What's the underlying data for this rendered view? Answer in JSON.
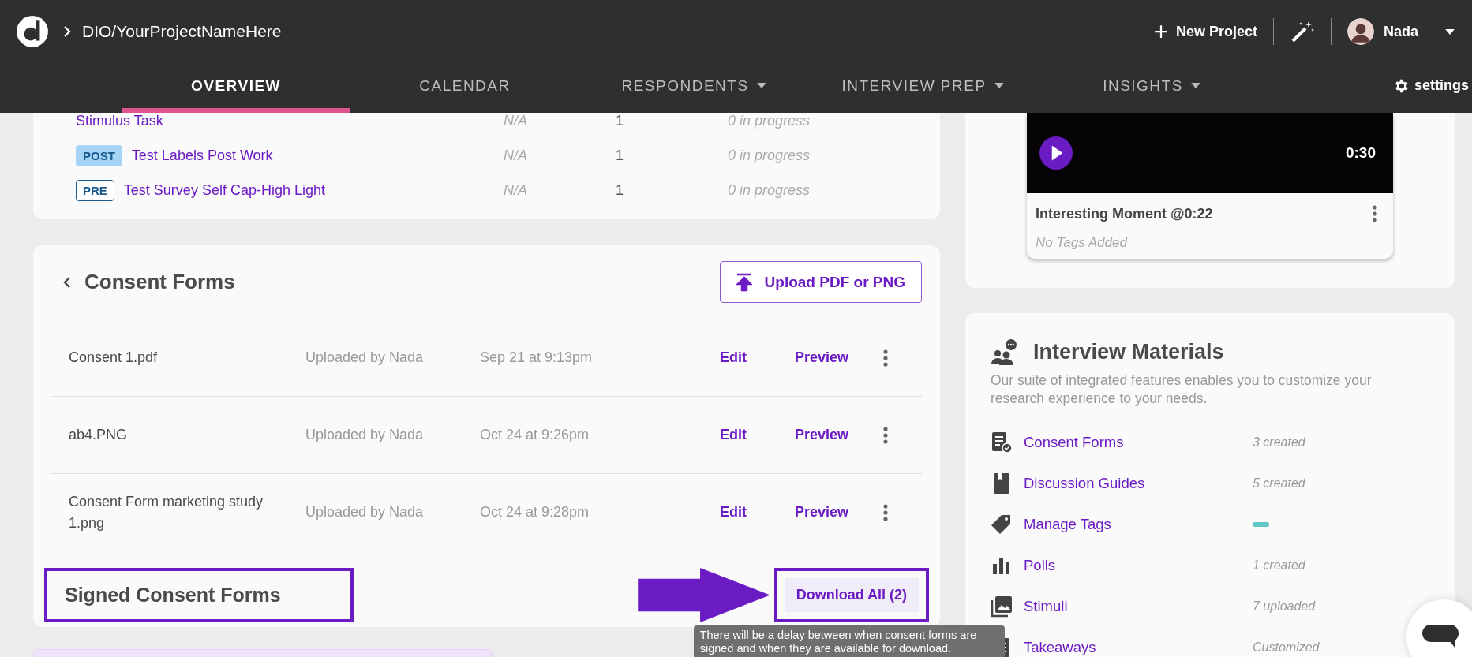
{
  "header": {
    "breadcrumb": "DIO/YourProjectNameHere",
    "new_project": "New Project",
    "user": "Nada"
  },
  "tabs": [
    {
      "label": "OVERVIEW",
      "selected": true,
      "dropdown": false
    },
    {
      "label": "CALENDAR",
      "selected": false,
      "dropdown": false
    },
    {
      "label": "RESPONDENTS",
      "selected": false,
      "dropdown": true
    },
    {
      "label": "INTERVIEW PREP",
      "selected": false,
      "dropdown": true
    },
    {
      "label": "INSIGHTS",
      "selected": false,
      "dropdown": true
    }
  ],
  "settings": "settings",
  "tasks": [
    {
      "name": "Stimulus Task",
      "due": "N/A",
      "count": "1",
      "progress": "0 in progress"
    },
    {
      "tag": {
        "text": "POST",
        "kind": "filled"
      },
      "name": "Test Labels Post Work",
      "due": "N/A",
      "count": "1",
      "progress": "0 in progress"
    },
    {
      "tag": {
        "text": "PRE",
        "kind": "outline"
      },
      "name": "Test Survey Self Cap-High Light",
      "due": "N/A",
      "count": "1",
      "progress": "0 in progress"
    }
  ],
  "consent_forms": {
    "title": "Consent Forms",
    "upload_button": "Upload PDF or PNG",
    "rows": [
      {
        "name": "Consent 1.pdf",
        "uploader": "Uploaded by Nada",
        "date": "Sep 21 at 9:13pm",
        "edit": "Edit",
        "preview": "Preview"
      },
      {
        "name": "ab4.PNG",
        "uploader": "Uploaded by Nada",
        "date": "Oct 24 at 9:26pm",
        "edit": "Edit",
        "preview": "Preview"
      },
      {
        "name": "Consent Form marketing study 1.png",
        "uploader": "Uploaded by Nada",
        "date": "Oct 24 at 9:28pm",
        "edit": "Edit",
        "preview": "Preview"
      }
    ]
  },
  "signed": {
    "title": "Signed Consent Forms",
    "download_button": "Download All (2)",
    "tooltip": "There will be a delay between when consent forms are signed and when they are available for download."
  },
  "video": {
    "duration": "0:30",
    "title": "Interesting Moment @0:22",
    "tags": "No Tags Added"
  },
  "materials": {
    "title": "Interview Materials",
    "description": "Our suite of integrated features enables you to customize your research experience to your needs.",
    "items": [
      {
        "label": "Consent Forms",
        "kind": "text",
        "status": "3 created"
      },
      {
        "label": "Discussion Guides",
        "kind": "text",
        "status": "5 created"
      },
      {
        "label": "Manage Tags",
        "kind": "bar"
      },
      {
        "label": "Polls",
        "kind": "text",
        "status": "1 created"
      },
      {
        "label": "Stimuli",
        "kind": "text",
        "status": "7 uploaded"
      },
      {
        "label": "Takeaways",
        "kind": "text",
        "status": "Customized"
      }
    ]
  }
}
